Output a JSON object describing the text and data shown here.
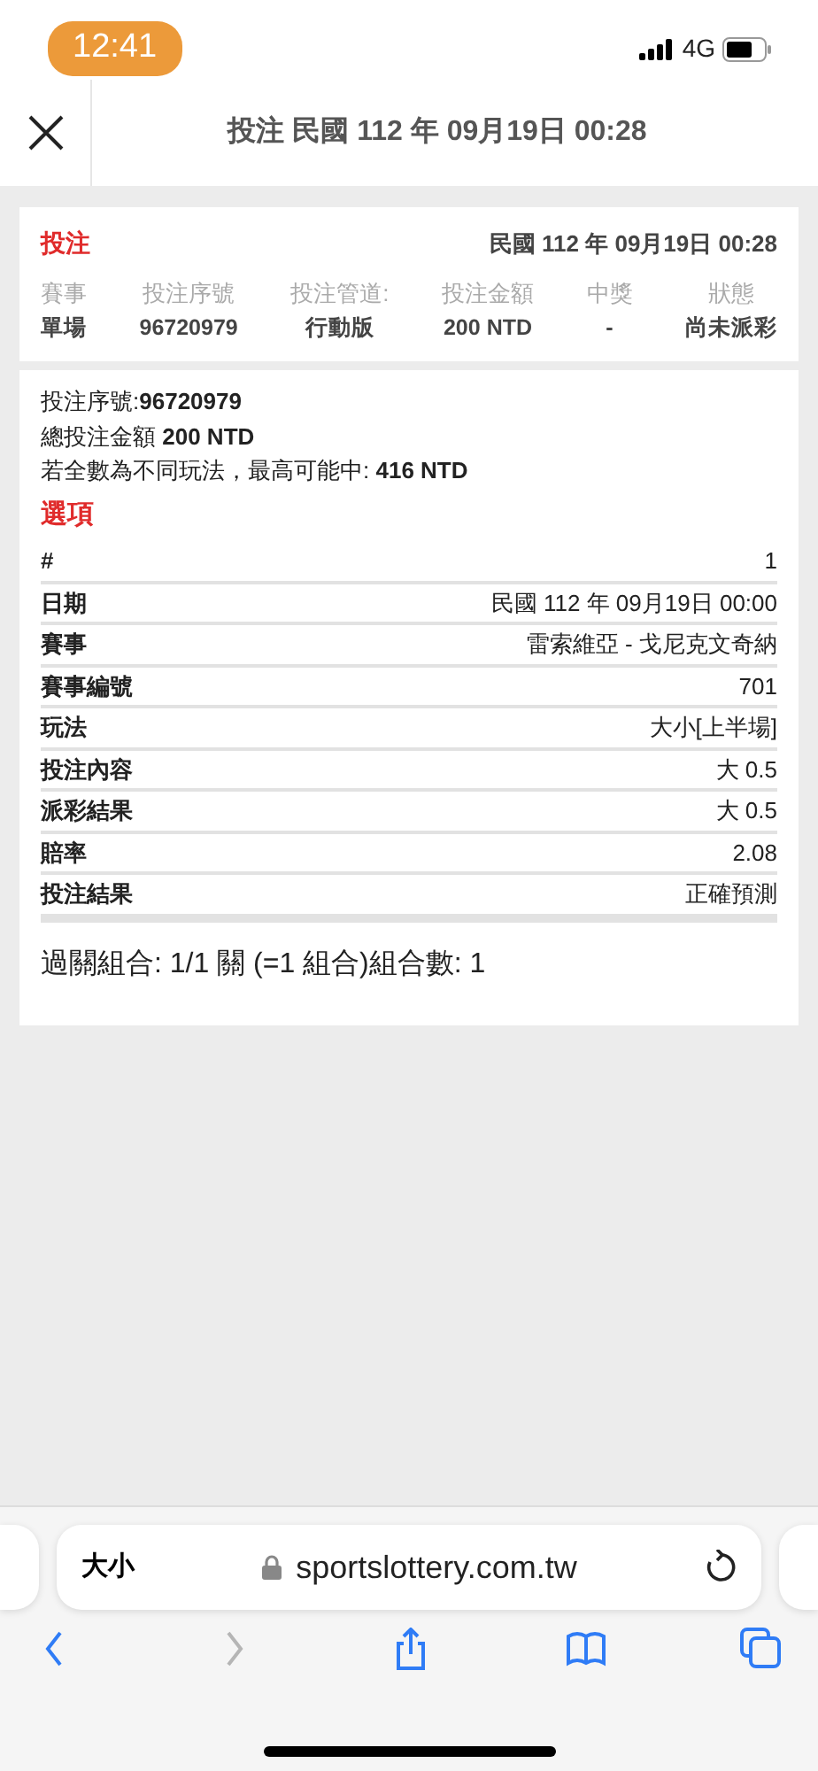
{
  "status_bar": {
    "time": "12:41",
    "network": "4G"
  },
  "header": {
    "title": "投注 民國 112 年 09月19日 00:28"
  },
  "bet_card": {
    "type": "投注",
    "datetime": "民國 112 年 09月19日 00:28",
    "columns": [
      {
        "label": "賽事",
        "value": "單場"
      },
      {
        "label": "投注序號",
        "value": "96720979"
      },
      {
        "label": "投注管道:",
        "value": "行動版"
      },
      {
        "label": "投注金額",
        "value": "200 NTD"
      },
      {
        "label": "中獎",
        "value": "-"
      },
      {
        "label": "狀態",
        "value": "尚未派彩"
      }
    ]
  },
  "detail": {
    "summary": [
      "投注序號:**96720979**",
      "總投注金額 **200 NTD**",
      "若全數為不同玩法，最高可能中: **416 NTD**"
    ],
    "options_title": "選項",
    "rows": [
      {
        "label": "#",
        "value": "1"
      },
      {
        "label": "日期",
        "value": "民國 112 年 09月19日 00:00"
      },
      {
        "label": "賽事",
        "value": "雷索維亞 - 戈尼克文奇納"
      },
      {
        "label": "賽事編號",
        "value": "701"
      },
      {
        "label": "玩法",
        "value": "大小[上半場]"
      },
      {
        "label": "投注內容",
        "value": "大 0.5"
      },
      {
        "label": "派彩結果",
        "value": "大 0.5"
      },
      {
        "label": "賠率",
        "value": "2.08"
      },
      {
        "label": "投注結果",
        "value": "正確預測"
      }
    ],
    "combo": "過關組合: 1/1 關 (=1 組合)組合數: 1"
  },
  "browser": {
    "text_size": "大小",
    "url": "sportslottery.com.tw",
    "toolbar": [
      {
        "kind": "back",
        "disabled": false
      },
      {
        "kind": "forward",
        "disabled": true
      },
      {
        "kind": "share",
        "disabled": false
      },
      {
        "kind": "bookmarks",
        "disabled": false
      },
      {
        "kind": "tabs",
        "disabled": false
      }
    ]
  }
}
